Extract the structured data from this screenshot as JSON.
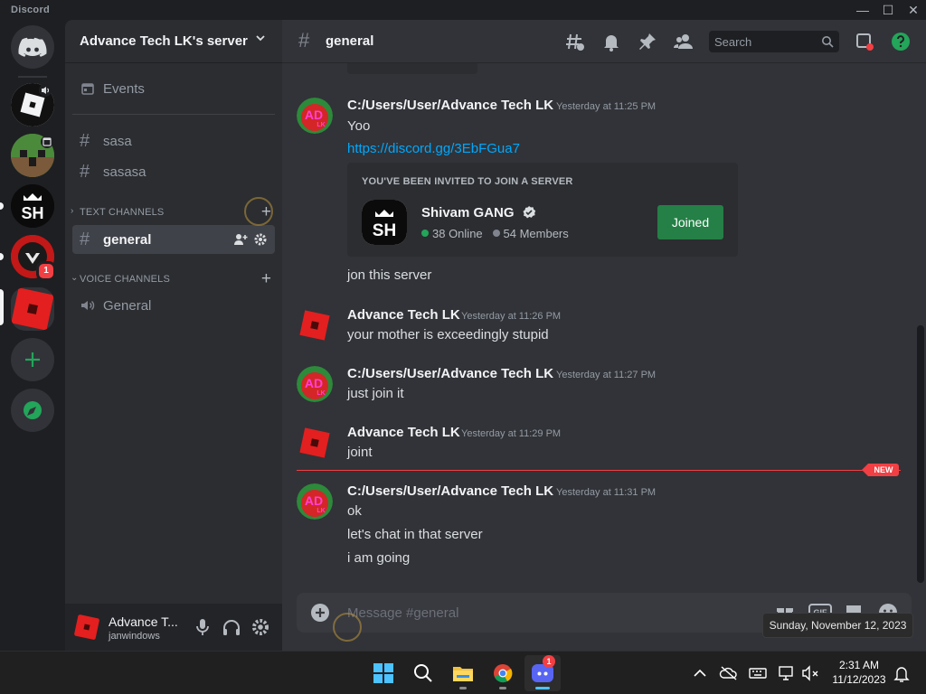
{
  "app": {
    "brand": "Discord"
  },
  "server": {
    "name": "Advance Tech LK's server"
  },
  "sidebar": {
    "events_label": "Events",
    "loose_channels": [
      {
        "label": "sasa"
      },
      {
        "label": "sasasa"
      }
    ],
    "text_category": "TEXT CHANNELS",
    "text_channels": [
      {
        "label": "general",
        "active": true
      }
    ],
    "voice_category": "VOICE CHANNELS",
    "voice_channels": [
      {
        "label": "General"
      }
    ]
  },
  "rail": {
    "servers": [
      {
        "name": "Home",
        "icon": "discord-logo-icon"
      },
      {
        "name": "Roblox server",
        "icon": "roblox-icon",
        "has_voice": true
      },
      {
        "name": "Minecraft server",
        "icon": "creeper-icon",
        "has_event": true
      },
      {
        "name": "Shivam GANG",
        "icon": "sh-logo-icon",
        "unread": true
      },
      {
        "name": "Red server",
        "icon": "red-logo-icon",
        "unread": true,
        "mentions": "1"
      },
      {
        "name": "Advance Tech LK's server",
        "icon": "roblox-square-icon",
        "selected": true
      }
    ],
    "add_server_icon": "plus-icon",
    "explore_icon": "compass-icon"
  },
  "user": {
    "name": "Advance T...",
    "tag": "janwindows"
  },
  "header": {
    "channel": "general"
  },
  "search": {
    "placeholder": "Search"
  },
  "messages": {
    "m1": {
      "author": "C:/Users/User/Advance Tech LK",
      "timestamp": "Yesterday at 11:25 PM",
      "line1": "Yoo",
      "link": "https://discord.gg/3EbFGua7",
      "invite": {
        "header": "YOU'VE BEEN INVITED TO JOIN A SERVER",
        "guild": "Shivam GANG",
        "online": "38 Online",
        "members": "54 Members",
        "button": "Joined"
      },
      "line2": "jon this server"
    },
    "m2": {
      "author": "Advance Tech LK",
      "timestamp": "Yesterday at 11:26 PM",
      "line1": "your mother is exceedingly stupid"
    },
    "m3": {
      "author": "C:/Users/User/Advance Tech LK",
      "timestamp": "Yesterday at 11:27 PM",
      "line1": "just join it"
    },
    "m4": {
      "author": "Advance Tech LK",
      "timestamp": "Yesterday at 11:29 PM",
      "line1": "joint"
    },
    "new_marker": "NEW",
    "m5": {
      "author": "C:/Users/User/Advance Tech LK",
      "timestamp": "Yesterday at 11:31 PM",
      "line1": "ok",
      "line2": "let's chat in that server",
      "line3": "i am going"
    }
  },
  "composer": {
    "placeholder": "Message #general",
    "gif_label": "GIF"
  },
  "tooltip": {
    "text": "Sunday, November 12, 2023"
  },
  "taskbar": {
    "discord_badge": "1",
    "time": "2:31 AM",
    "date": "11/12/2023"
  },
  "colors": {
    "accent_green": "#248046",
    "link": "#00a8fc",
    "new_marker": "#f23f43",
    "online": "#23a55a"
  }
}
